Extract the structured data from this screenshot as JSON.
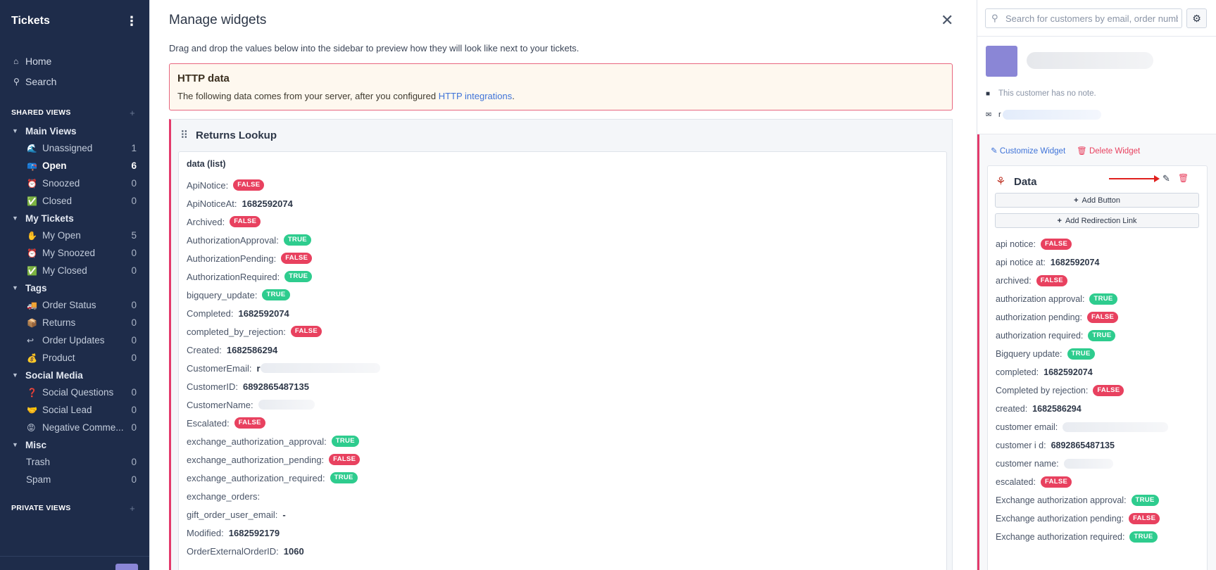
{
  "sidebar": {
    "title": "Tickets",
    "nav": [
      {
        "label": "Home",
        "icon": "home-icon"
      },
      {
        "label": "Search",
        "icon": "search-icon"
      }
    ],
    "shared_views_label": "SHARED VIEWS",
    "private_views_label": "PRIVATE VIEWS",
    "groups": [
      {
        "label": "Main Views",
        "items": [
          {
            "label": "Unassigned",
            "icon": "wave-icon",
            "count": "1"
          },
          {
            "label": "Open",
            "icon": "inbox-icon",
            "count": "6",
            "active": true
          },
          {
            "label": "Snoozed",
            "icon": "alarm-clock-icon",
            "count": "0"
          },
          {
            "label": "Closed",
            "icon": "check-mark-icon",
            "count": "0"
          }
        ]
      },
      {
        "label": "My Tickets",
        "items": [
          {
            "label": "My Open",
            "icon": "hand-icon",
            "count": "5"
          },
          {
            "label": "My Snoozed",
            "icon": "alarm-clock-icon",
            "count": "0"
          },
          {
            "label": "My Closed",
            "icon": "check-mark-icon",
            "count": "0"
          }
        ]
      },
      {
        "label": "Tags",
        "items": [
          {
            "label": "Order Status",
            "icon": "truck-icon",
            "count": "0"
          },
          {
            "label": "Returns",
            "icon": "package-icon",
            "count": "0"
          },
          {
            "label": "Order Updates",
            "icon": "return-arrow-icon",
            "count": "0"
          },
          {
            "label": "Product",
            "icon": "money-bag-icon",
            "count": "0"
          }
        ]
      },
      {
        "label": "Social Media",
        "items": [
          {
            "label": "Social Questions",
            "icon": "question-mark-icon",
            "count": "0"
          },
          {
            "label": "Social Lead",
            "icon": "handshake-icon",
            "count": "0"
          },
          {
            "label": "Negative Comme...",
            "icon": "angry-face-icon",
            "count": "0"
          }
        ]
      },
      {
        "label": "Misc",
        "items": [
          {
            "label": "Trash",
            "icon": "",
            "count": "0"
          },
          {
            "label": "Spam",
            "icon": "",
            "count": "0"
          }
        ]
      }
    ]
  },
  "modal": {
    "title": "Manage widgets",
    "description": "Drag and drop the values below into the sidebar to preview how they will look like next to your tickets.",
    "http": {
      "title": "HTTP data",
      "text": "The following data comes from your server, after you configured ",
      "link": "HTTP integrations",
      "after": "."
    },
    "lookup": {
      "title": "Returns Lookup",
      "list_title": "data (list)",
      "rows": [
        {
          "k": "ApiNotice:",
          "b": "FALSE"
        },
        {
          "k": "ApiNoticeAt:",
          "v": "1682592074"
        },
        {
          "k": "Archived:",
          "b": "FALSE"
        },
        {
          "k": "AuthorizationApproval:",
          "b": "TRUE"
        },
        {
          "k": "AuthorizationPending:",
          "b": "FALSE"
        },
        {
          "k": "AuthorizationRequired:",
          "b": "TRUE"
        },
        {
          "k": "bigquery_update:",
          "b": "TRUE"
        },
        {
          "k": "Completed:",
          "v": "1682592074"
        },
        {
          "k": "completed_by_rejection:",
          "b": "FALSE"
        },
        {
          "k": "Created:",
          "v": "1682586294"
        },
        {
          "k": "CustomerEmail:",
          "v": "r",
          "blur": 170
        },
        {
          "k": "CustomerID:",
          "v": "6892865487135"
        },
        {
          "k": "CustomerName:",
          "blur": 80
        },
        {
          "k": "Escalated:",
          "b": "FALSE"
        },
        {
          "k": "exchange_authorization_approval:",
          "b": "TRUE"
        },
        {
          "k": "exchange_authorization_pending:",
          "b": "FALSE"
        },
        {
          "k": "exchange_authorization_required:",
          "b": "TRUE"
        },
        {
          "k": "exchange_orders:"
        },
        {
          "k": "gift_order_user_email:",
          "v": "-"
        },
        {
          "k": "Modified:",
          "v": "1682592179"
        },
        {
          "k": "OrderExternalOrderID:",
          "v": "1060"
        }
      ]
    }
  },
  "right_panel": {
    "search_placeholder": "Search for customers by email, order number",
    "note": "This customer has no note.",
    "mail_prefix": "r",
    "customize_label": "Customize Widget",
    "delete_label": "Delete Widget",
    "widget_title": "Data",
    "add_button_label": "Add Button",
    "add_redirection_label": "Add Redirection Link",
    "rows": [
      {
        "k": "api notice:",
        "b": "FALSE"
      },
      {
        "k": "api notice at:",
        "v": "1682592074"
      },
      {
        "k": "archived:",
        "b": "FALSE"
      },
      {
        "k": "authorization approval:",
        "b": "TRUE"
      },
      {
        "k": "authorization pending:",
        "b": "FALSE"
      },
      {
        "k": "authorization required:",
        "b": "TRUE"
      },
      {
        "k": "Bigquery update:",
        "b": "TRUE"
      },
      {
        "k": "completed:",
        "v": "1682592074"
      },
      {
        "k": "Completed by rejection:",
        "b": "FALSE"
      },
      {
        "k": "created:",
        "v": "1682586294"
      },
      {
        "k": "customer email:",
        "blur": 150
      },
      {
        "k": "customer i d:",
        "v": "6892865487135"
      },
      {
        "k": "customer name:",
        "blur": 70
      },
      {
        "k": "escalated:",
        "b": "FALSE"
      },
      {
        "k": "Exchange authorization approval:",
        "b": "TRUE"
      },
      {
        "k": "Exchange authorization pending:",
        "b": "FALSE"
      },
      {
        "k": "Exchange authorization required:",
        "b": "TRUE"
      }
    ]
  },
  "colors": {
    "sidebar_bg": "#1e2c4a",
    "accent_pink": "#e33a6b",
    "false_badge": "#e8415f",
    "true_badge": "#2ecc8e",
    "link_blue": "#3f73d8",
    "avatar_purple": "#8a86d6"
  }
}
